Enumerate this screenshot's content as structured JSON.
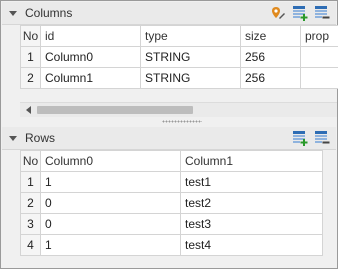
{
  "columns_panel": {
    "title": "Columns",
    "icons": [
      "edit-pin-icon",
      "add-column-icon",
      "remove-column-icon"
    ],
    "headers": [
      "No",
      "id",
      "type",
      "size",
      "prop"
    ],
    "rows": [
      {
        "no": "1",
        "id": "Column0",
        "type": "STRING",
        "size": "256",
        "prop": ""
      },
      {
        "no": "2",
        "id": "Column1",
        "type": "STRING",
        "size": "256",
        "prop": ""
      }
    ]
  },
  "rows_panel": {
    "title": "Rows",
    "icons": [
      "add-row-icon",
      "remove-row-icon"
    ],
    "headers": [
      "No",
      "Column0",
      "Column1"
    ],
    "rows": [
      {
        "no": "1",
        "c0": "1",
        "c1": "test1"
      },
      {
        "no": "2",
        "c0": "0",
        "c1": "test2"
      },
      {
        "no": "3",
        "c0": "0",
        "c1": "test3"
      },
      {
        "no": "4",
        "c0": "1",
        "c1": "test4"
      }
    ]
  },
  "colors": {
    "header_bg": "#eaeaea",
    "grid_line": "#d4d4d4",
    "icon_blue": "#2e6db4",
    "icon_orange": "#e08a1e"
  }
}
